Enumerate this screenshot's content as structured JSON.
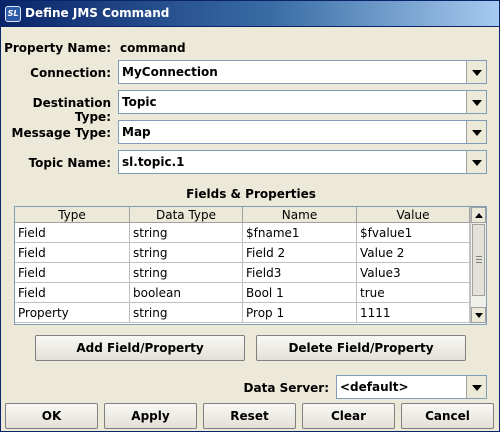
{
  "window": {
    "title": "Define JMS Command",
    "icon_text": "SL"
  },
  "form": {
    "property_name_label": "Property Name:",
    "property_name_value": "command",
    "connection_label": "Connection:",
    "connection_value": "MyConnection",
    "destination_type_label": "Destination Type:",
    "destination_type_value": "Topic",
    "message_type_label": "Message Type:",
    "message_type_value": "Map",
    "topic_name_label": "Topic Name:",
    "topic_name_value": "sl.topic.1"
  },
  "fields_section": {
    "title": "Fields & Properties",
    "columns": [
      "Type",
      "Data Type",
      "Name",
      "Value"
    ],
    "rows": [
      [
        "Field",
        "string",
        "$fname1",
        "$fvalue1"
      ],
      [
        "Field",
        "string",
        "Field 2",
        "Value 2"
      ],
      [
        "Field",
        "string",
        "Field3",
        "Value3"
      ],
      [
        "Field",
        "boolean",
        "Bool 1",
        "true"
      ],
      [
        "Property",
        "string",
        "Prop 1",
        "1111"
      ]
    ]
  },
  "actions": {
    "add_label": "Add Field/Property",
    "delete_label": "Delete Field/Property"
  },
  "data_server": {
    "label": "Data Server:",
    "value": "<default>"
  },
  "footer": {
    "ok_label": "OK",
    "apply_label": "Apply",
    "reset_label": "Reset",
    "clear_label": "Clear",
    "cancel_label": "Cancel"
  },
  "colors": {
    "titlebar": "#0a246a",
    "window_bg": "#ece9d8"
  },
  "icons": [
    "app-icon",
    "chevron-down-icon",
    "scroll-up-icon",
    "scroll-down-icon"
  ]
}
